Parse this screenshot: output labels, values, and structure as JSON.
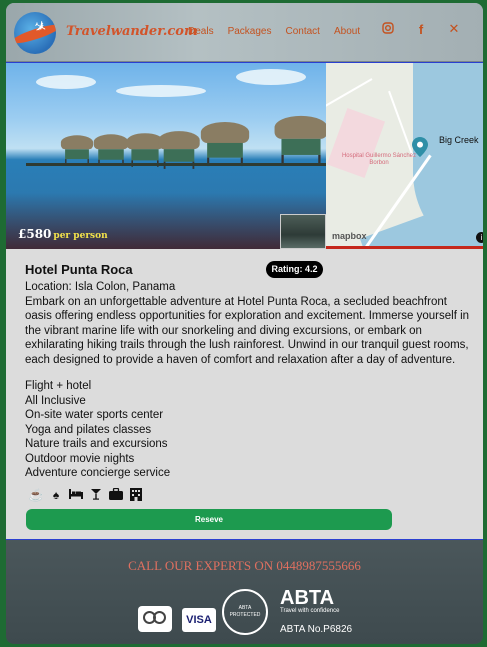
{
  "header": {
    "brand": "Travelwander.com",
    "nav": [
      "Deals",
      "Packages",
      "Contact",
      "About"
    ],
    "social": [
      "instagram-icon",
      "facebook-icon",
      "x-icon"
    ]
  },
  "hero": {
    "price": "£580",
    "price_suffix": "per person",
    "map": {
      "place_label": "Big Creek",
      "poi_label": "Hospital Guillermo Sánchez Borbon",
      "attribution": "mapbox"
    }
  },
  "hotel": {
    "name": "Hotel Punta Roca",
    "rating": "Rating: 4.2",
    "location": "Location: Isla Colon, Panama",
    "description": "Embark on an unforgettable adventure at Hotel Punta Roca, a secluded beachfront oasis offering endless opportunities for exploration and excitement. Immerse yourself in the vibrant marine life with our snorkeling and diving excursions, or embark on exhilarating hiking trails through the lush rainforest. Unwind in our tranquil guest rooms, each designed to provide a haven of comfort and relaxation after a day of adventure.",
    "features": [
      "Flight + hotel",
      "All Inclusive",
      "On-site water sports center",
      "Yoga and pilates classes",
      "Nature trails and excursions",
      "Outdoor movie nights",
      "Adventure concierge service"
    ],
    "amenity_icons": [
      "coffee-icon",
      "ice-cream-icon",
      "bed-icon",
      "cocktail-icon",
      "briefcase-icon",
      "hotel-icon"
    ],
    "reserve_label": "Reseve"
  },
  "footer": {
    "call_text": "CALL OUR EXPERTS ON 0448987555666",
    "visa": "VISA",
    "abta": "ABTA",
    "abta_tag": "Travel with confidence",
    "abta_no": "ABTA No.P6826"
  }
}
